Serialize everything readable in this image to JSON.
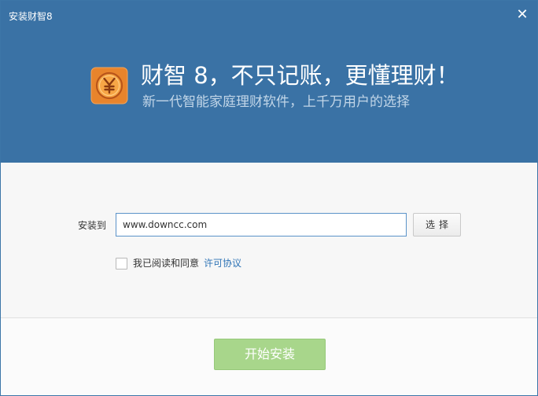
{
  "window": {
    "title": "安装财智8",
    "close_icon": "close-icon"
  },
  "header": {
    "logo_icon": "yen-coin-icon",
    "slogan": "财智 8，不只记账，更懂理财！",
    "subtitle": "新一代智能家庭理财软件，上千万用户的选择",
    "background_color": "#3a72a5"
  },
  "install": {
    "label": "安装到",
    "path_value": "www.downcc.com",
    "choose_label": "选择"
  },
  "agreement": {
    "checked": false,
    "text": "我已阅读和同意",
    "link_text": "许可协议"
  },
  "footer": {
    "start_label": "开始安装",
    "button_color": "#a8d68b"
  }
}
